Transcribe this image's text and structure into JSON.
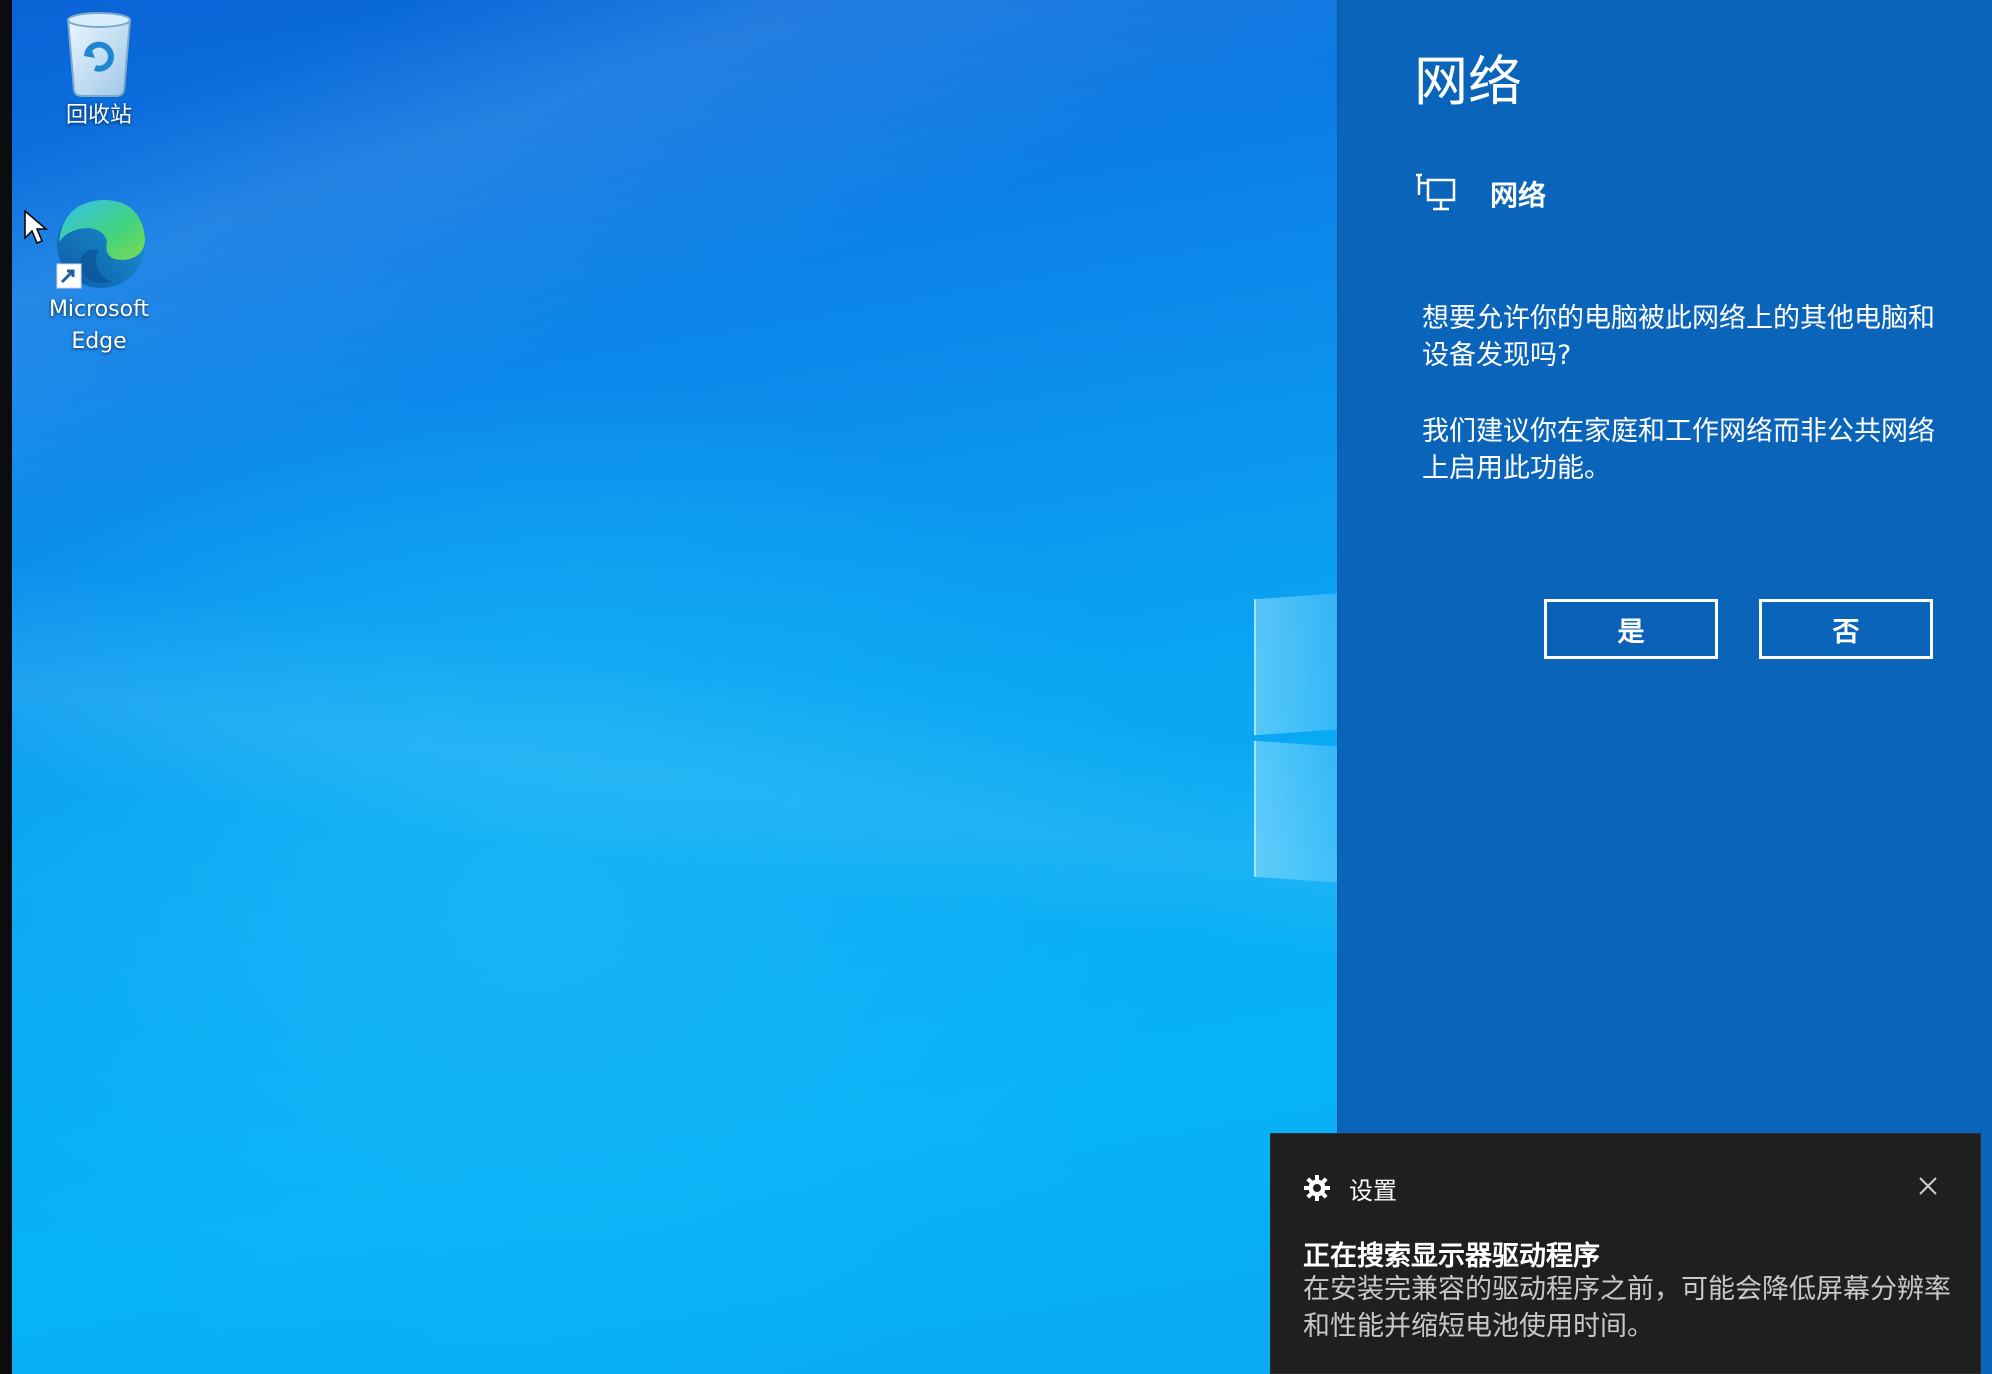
{
  "desktop": {
    "icons": [
      {
        "label": "回收站",
        "icon": "recycle-bin-icon"
      },
      {
        "label": "Microsoft\nEdge",
        "icon": "edge-icon"
      }
    ]
  },
  "network_flyout": {
    "title": "网络",
    "network_icon": "network-monitor-icon",
    "network_name": "网络",
    "question": "想要允许你的电脑被此网络上的其他电脑和设备发现吗?",
    "recommendation": "我们建议你在家庭和工作网络而非公共网络上启用此功能。",
    "yes_label": "是",
    "no_label": "否",
    "colors": {
      "background": "#0a64b9",
      "text": "#ffffff"
    }
  },
  "notification": {
    "app_icon": "gear-icon",
    "app_name": "设置",
    "close_icon": "close-icon",
    "title": "正在搜索显示器驱动程序",
    "body": "在安装完兼容的驱动程序之前，可能会降低屏幕分辨率和性能并缩短电池使用时间。",
    "colors": {
      "background": "#1f1f1f",
      "body_text": "#c8c8c8"
    }
  }
}
